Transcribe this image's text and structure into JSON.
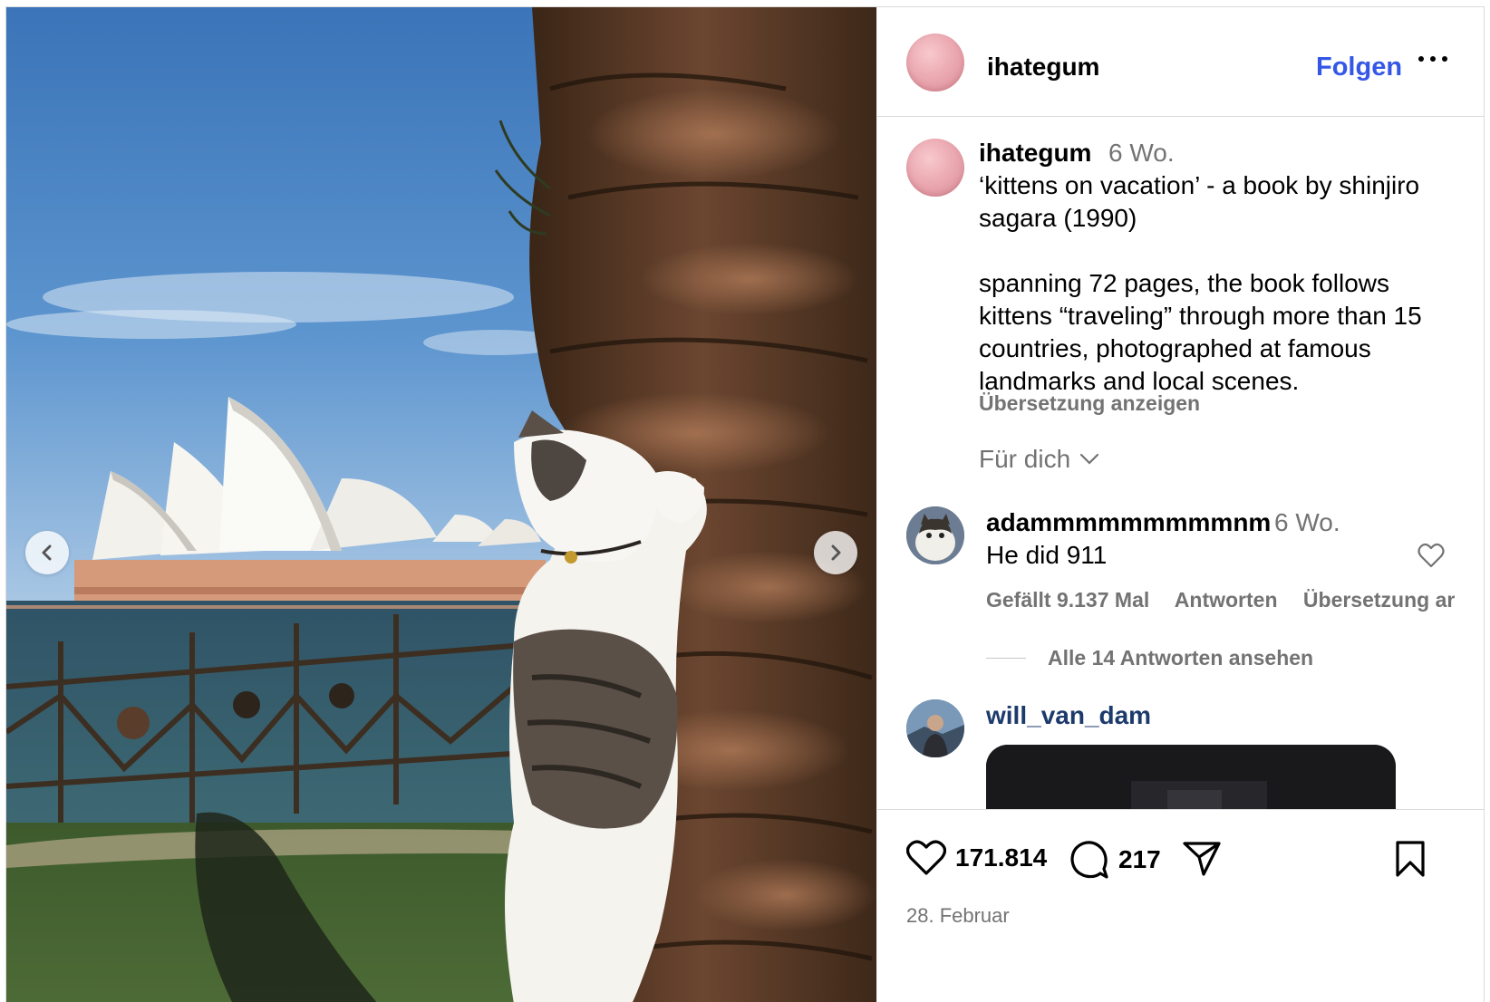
{
  "post": {
    "username": "ihategum",
    "follow_label": "Folgen",
    "caption": {
      "username": "ihategum",
      "time": "6 Wo.",
      "text": "‘kittens on vacation’ - a book by shinjiro sagara (1990)\n\nspanning 72 pages, the book follows kittens “traveling” through more than 15 countries, photographed at famous landmarks and local scenes.",
      "translate_label": "Übersetzung anzeigen"
    },
    "for_you_label": "Für dich",
    "comments": [
      {
        "username": "adammmmmmmmmnm",
        "time": "6 Wo.",
        "text": "He did 911",
        "likes_label": "Gefällt 9.137 Mal",
        "reply_label": "Antworten",
        "translate_label": "Übersetzung ar",
        "view_replies_label": "Alle 14 Antworten ansehen"
      },
      {
        "username": "will_van_dam"
      }
    ],
    "likes_count": "171.814",
    "comments_count": "217",
    "date": "28. Februar"
  },
  "icons": {
    "prev": "chevron-left-icon",
    "next": "chevron-right-icon",
    "more": "more-horizontal-icon",
    "like": "heart-icon",
    "comment": "comment-icon",
    "share": "share-icon",
    "save": "bookmark-icon"
  },
  "colors": {
    "accent": "#3557e6",
    "muted": "#737373",
    "link_user": "#1c3a6b"
  }
}
